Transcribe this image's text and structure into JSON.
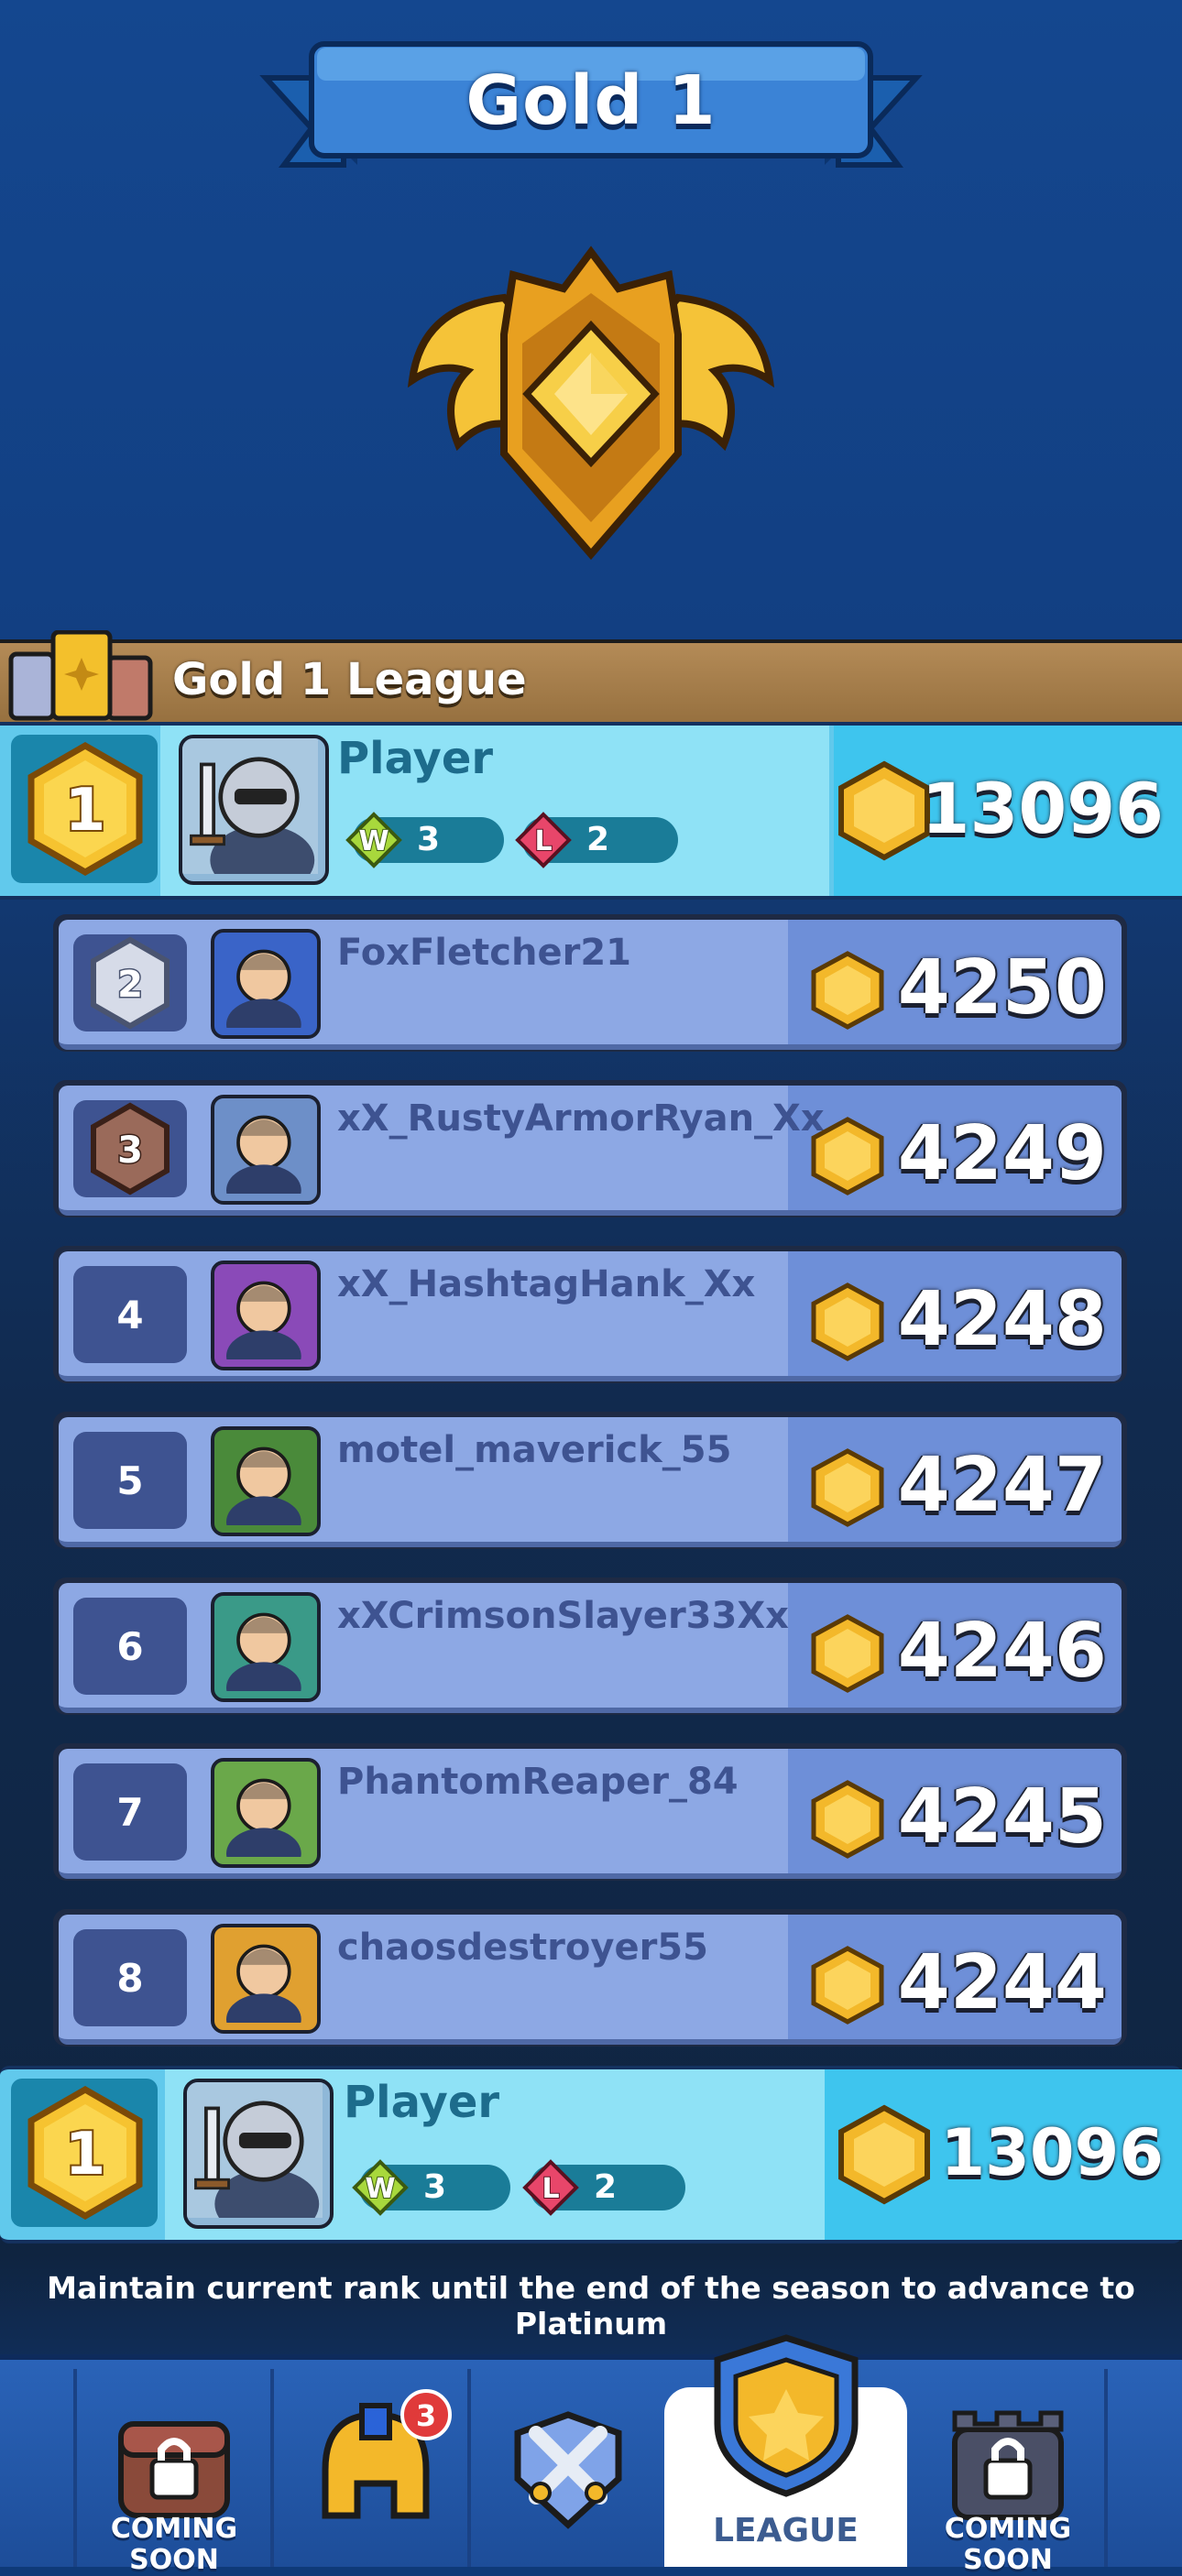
{
  "header": {
    "title": "Gold 1"
  },
  "league": {
    "title": "Gold 1 League"
  },
  "player": {
    "rank": "1",
    "name": "Player",
    "wins": "3",
    "losses": "2",
    "score": "13096",
    "win_letter": "W",
    "loss_letter": "L"
  },
  "leaderboard": [
    {
      "rank": "2",
      "name": "FoxFletcher21",
      "score": "4250"
    },
    {
      "rank": "3",
      "name": "xX_RustyArmorRyan_Xx",
      "score": "4249"
    },
    {
      "rank": "4",
      "name": "xX_HashtagHank_Xx",
      "score": "4248"
    },
    {
      "rank": "5",
      "name": "motel_maverick_55",
      "score": "4247"
    },
    {
      "rank": "6",
      "name": "xXCrimsonSlayer33Xx",
      "score": "4246"
    },
    {
      "rank": "7",
      "name": "PhantomReaper_84",
      "score": "4245"
    },
    {
      "rank": "8",
      "name": "chaosdestroyer55",
      "score": "4244"
    }
  ],
  "footer": {
    "message": "Maintain current rank until the end of the season to advance to Platinum"
  },
  "nav": {
    "item1": "COMING SOON",
    "item2_badge": "3",
    "item4": "LEAGUE",
    "item5": "COMING SOON"
  },
  "colors": {
    "gold": "#f3b82a",
    "highlight": "#61c9ec",
    "row": "#8da8e4",
    "nav": "#2a63b8"
  }
}
